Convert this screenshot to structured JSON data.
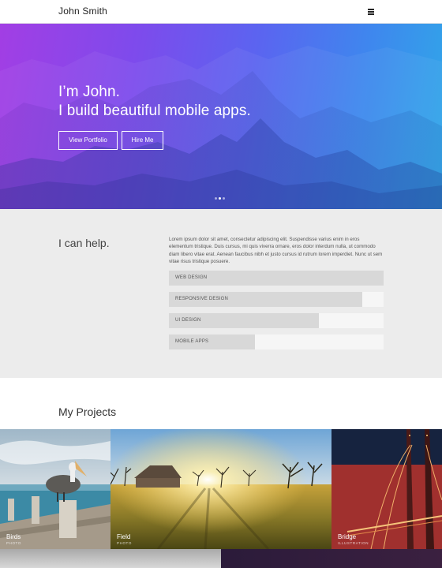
{
  "header": {
    "brand": "John Smith",
    "menu_icon": "hamburger-menu-icon"
  },
  "hero": {
    "line1": "I’m John.",
    "line2": "I build beautiful mobile apps.",
    "primary_button": "View Portfolio",
    "secondary_button": "Hire Me",
    "slides": 3,
    "active_slide": 2,
    "gradient_colors": [
      "#a23ee4",
      "#5b64f0",
      "#2fa9e8"
    ]
  },
  "help": {
    "title": "I can help.",
    "text": "Lorem ipsum dolor sit amet, consectetur adipiscing elit. Suspendisse varius enim in eros elementum tristique. Duis cursus, mi quis viverra ornare, eros dolor interdum nulla, ut commodo diam libero vitae erat. Aenean faucibus nibh et justo cursus id rutrum lorem imperdiet. Nunc ut sem vitae risus tristique posuere.",
    "skills": [
      {
        "label": "WEB DESIGN",
        "level": 1.0
      },
      {
        "label": "RESPONSIVE DESIGN",
        "level": 0.9
      },
      {
        "label": "UI DESIGN",
        "level": 0.7
      },
      {
        "label": "MOBILE APPS",
        "level": 0.4
      }
    ]
  },
  "projects": {
    "title": "My Projects",
    "items": [
      {
        "name": "Birds",
        "category": "PHOTO"
      },
      {
        "name": "Field",
        "category": "PHOTO"
      },
      {
        "name": "Bridge",
        "category": "ILLUSTRATION"
      }
    ]
  }
}
